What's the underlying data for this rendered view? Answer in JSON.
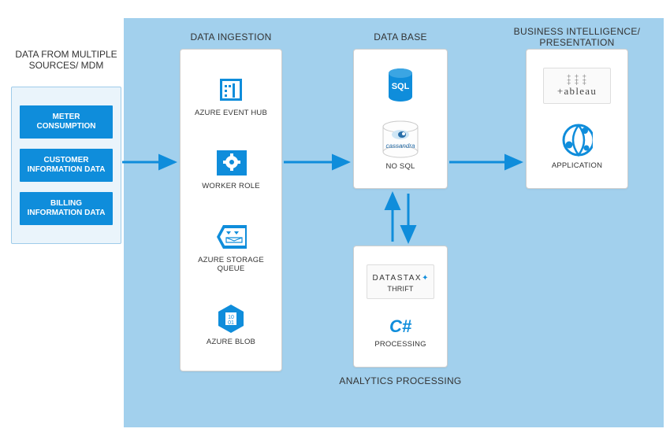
{
  "sources": {
    "title": "DATA FROM MULTIPLE SOURCES/ MDM",
    "items": [
      "METER CONSUMPTION",
      "CUSTOMER INFORMATION DATA",
      "BILLING INFORMATION DATA"
    ]
  },
  "ingestion": {
    "title": "DATA INGESTION",
    "items": [
      {
        "label": "AZURE EVENT HUB",
        "icon": "event-hub-icon"
      },
      {
        "label": "WORKER ROLE",
        "icon": "worker-role-icon"
      },
      {
        "label": "AZURE STORAGE  QUEUE",
        "icon": "storage-queue-icon"
      },
      {
        "label": "AZURE BLOB",
        "icon": "blob-icon"
      }
    ]
  },
  "database": {
    "title": "DATA BASE",
    "sql_label": "SQL",
    "nosql_label": "NO SQL",
    "nosql_vendor": "cassandra"
  },
  "bi": {
    "title": "BUSINESS INTELLIGENCE/ PRESENTATION",
    "tableau": "+ableau",
    "app_label": "APPLICATION"
  },
  "analytics": {
    "title": "ANALYTICS PROCESSING",
    "thrift_label": "THRIFT",
    "datastax": "DATASTAX",
    "csharp": "C#",
    "processing_label": "PROCESSING"
  },
  "colors": {
    "azure_blue": "#0f8ddb",
    "region_blue": "#a2d0ed",
    "light_blue": "#eaf4fb"
  }
}
